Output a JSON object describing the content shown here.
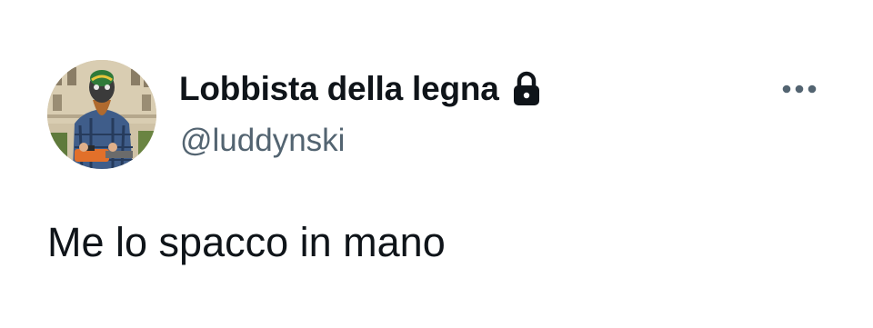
{
  "tweet": {
    "author": {
      "display_name": "Lobbista della legna",
      "handle": "@luddynski",
      "protected_icon": "lock-icon",
      "avatar": "profile-avatar"
    },
    "text": "Me lo spacco in mano",
    "more_icon": "more-horizontal-icon"
  },
  "colors": {
    "primary_text": "#0f1419",
    "secondary_text": "#536471",
    "background": "#ffffff"
  }
}
